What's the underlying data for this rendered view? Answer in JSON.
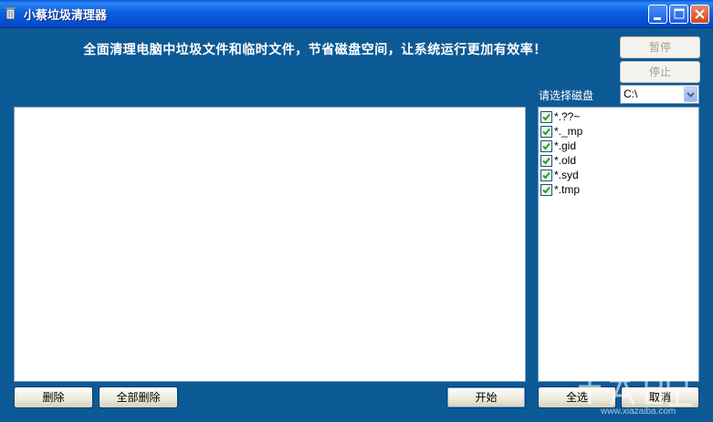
{
  "window": {
    "title": "小蔡垃圾清理器"
  },
  "headline": "全面清理电脑中垃圾文件和临时文件，节省磁盘空间，让系统运行更加有效率！",
  "controls": {
    "pause_label": "暂停",
    "stop_label": "停止",
    "drive_label": "请选择磁盘",
    "drive_value": "C:\\"
  },
  "extensions": [
    {
      "label": "*.??~",
      "checked": true
    },
    {
      "label": "*._mp",
      "checked": true
    },
    {
      "label": "*.gid",
      "checked": true
    },
    {
      "label": "*.old",
      "checked": true
    },
    {
      "label": "*.syd",
      "checked": true
    },
    {
      "label": "*.tmp",
      "checked": true
    }
  ],
  "bottom_buttons": {
    "delete_label": "删除",
    "delete_all_label": "全部删除",
    "start_label": "开始",
    "select_all_label": "全选",
    "cancel_label": "取消"
  },
  "watermark": {
    "text": "www.xiazaiba.com"
  },
  "colors": {
    "background": "#0c5a95",
    "titlebar": "#0a5fdf"
  }
}
